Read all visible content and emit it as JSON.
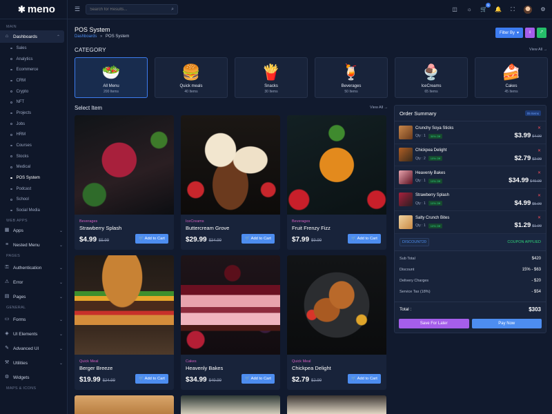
{
  "app": {
    "logo": "meno",
    "logo_icon": "asterisk-icon"
  },
  "search": {
    "placeholder": "Search for Results..."
  },
  "topbar": {
    "cart_badge": "5"
  },
  "sidebar": {
    "sections": {
      "main": "MAIN",
      "web_apps": "WEB APPS",
      "pages": "PAGES",
      "general": "GENERAL",
      "maps": "MAPS & ICONS"
    },
    "dashboards": "Dashboards",
    "sub_items": [
      "Sales",
      "Analytics",
      "Ecommerce",
      "CRM",
      "Crypto",
      "NFT",
      "Projects",
      "Jobs",
      "HRM",
      "Courses",
      "Stocks",
      "Medical",
      "POS System",
      "Podcast",
      "School",
      "Social Media"
    ],
    "apps": "Apps",
    "nested_menu": "Nested Menu",
    "authentication": "Authentication",
    "error": "Error",
    "pages": "Pages",
    "forms": "Forms",
    "ui_elements": "UI Elements",
    "advanced_ui": "Advanced UI",
    "utilities": "Utilities",
    "widgets": "Widgets"
  },
  "header": {
    "title": "POS System",
    "breadcrumb_link": "Dashboards",
    "breadcrumb_sep": "»",
    "breadcrumb_current": "POS System",
    "filter_label": "Filter By"
  },
  "category": {
    "title": "CATEGORY",
    "view_all": "View All →",
    "items": [
      {
        "name": "All Menu",
        "count": "200 Items",
        "icon": "🥗"
      },
      {
        "name": "Quick meals",
        "count": "40 Items",
        "icon": "🍔"
      },
      {
        "name": "Snacks",
        "count": "30 Items",
        "icon": "🍟"
      },
      {
        "name": "Beverages",
        "count": "50 Items",
        "icon": "🍹"
      },
      {
        "name": "IceCreams",
        "count": "65 Items",
        "icon": "🍨"
      },
      {
        "name": "Cakes",
        "count": "45 Items",
        "icon": "🍰"
      }
    ]
  },
  "select_item": {
    "title": "Select Item",
    "view_all": "View All →",
    "add_label": "🛒 Add to Cart",
    "items": [
      {
        "category": "Beverages",
        "name": "Strawberry Splash",
        "price": "$4.99",
        "old": "$5.99"
      },
      {
        "category": "IceCreams",
        "name": "Buttercream Grove",
        "price": "$29.99",
        "old": "$34.99"
      },
      {
        "category": "Beverages",
        "name": "Fruit Frenzy Fizz",
        "price": "$7.99",
        "old": "$9.99"
      },
      {
        "category": "Quick Meal",
        "name": "Berger Breeze",
        "price": "$19.99",
        "old": "$24.99"
      },
      {
        "category": "Cakes",
        "name": "Heavenly Bakes",
        "price": "$34.99",
        "old": "$49.99"
      },
      {
        "category": "Quick Meal",
        "name": "Chickpea Delight",
        "price": "$2.79",
        "old": "$2.99"
      }
    ]
  },
  "order": {
    "title": "Order Summary",
    "badge": "05 Items",
    "items": [
      {
        "name": "Crunchy Soya Sticks",
        "qty": "Qty : 1",
        "off": "30% Off",
        "price": "$3.99",
        "old": "$4.99"
      },
      {
        "name": "Chickpea Delight",
        "qty": "Qty : 2",
        "off": "10% Off",
        "price": "$2.79",
        "old": "$2.99"
      },
      {
        "name": "Heavenly Bakes",
        "qty": "Qty : 1",
        "off": "10% Off",
        "price": "$34.99",
        "old": "$49.99"
      },
      {
        "name": "Strawberry Splash",
        "qty": "Qty : 1",
        "off": "10% Off",
        "price": "$4.99",
        "old": "$5.99"
      },
      {
        "name": "Salty Crunch Bites",
        "qty": "Qty : 1",
        "off": "10% Off",
        "price": "$1.29",
        "old": "$1.99"
      }
    ],
    "coupon_code": "DISCOUNT20",
    "coupon_status": "COUPON APPLIED",
    "totals": [
      {
        "label": "Sub Total",
        "value": "$420"
      },
      {
        "label": "Discount",
        "value": "15% - $63"
      },
      {
        "label": "Delivery Charges",
        "value": "- $20"
      },
      {
        "label": "Service Tax (18%)",
        "value": "- $54"
      }
    ],
    "total_label": "Total :",
    "total_value": "$303",
    "save_label": "Save For Later",
    "pay_label": "Pay Now"
  },
  "colors": {
    "accent": "#3d7cf0",
    "purple": "#a55eea",
    "green": "#26bf6a",
    "category_pink": "#d25dbf"
  }
}
